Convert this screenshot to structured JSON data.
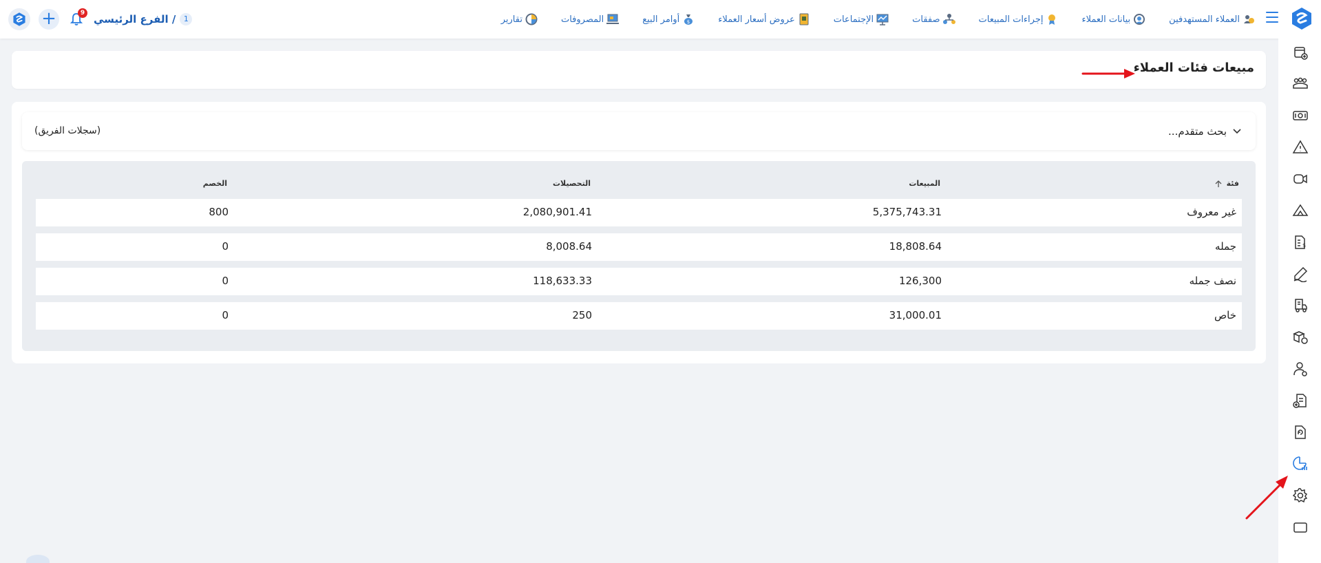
{
  "branch": {
    "number": "1",
    "name": "الفرع الرئيسي /"
  },
  "notifications": {
    "count": "9"
  },
  "nav_items": [
    {
      "label": "العملاء المستهدفين",
      "icon": "target-customers-icon"
    },
    {
      "label": "بيانات العملاء",
      "icon": "customer-data-icon"
    },
    {
      "label": "إجراءات المبيعات",
      "icon": "sales-actions-icon"
    },
    {
      "label": "صفقات",
      "icon": "deals-icon"
    },
    {
      "label": "الإجتماعات",
      "icon": "meetings-icon"
    },
    {
      "label": "عروض أسعار العملاء",
      "icon": "quotes-icon"
    },
    {
      "label": "أوامر البيع",
      "icon": "sales-orders-icon"
    },
    {
      "label": "المصروفات",
      "icon": "expenses-icon"
    },
    {
      "label": "تقارير",
      "icon": "reports-icon"
    }
  ],
  "page": {
    "title": "مبيعات فئات العملاء"
  },
  "search": {
    "advanced_label": "بحث متقدم...",
    "team_records": "(سجلات الفريق)"
  },
  "table": {
    "headers": {
      "category": "فئة",
      "sales": "المبيعات",
      "collections": "التحصيلات",
      "discount": "الخصم"
    },
    "rows": [
      {
        "category": "غير معروف",
        "sales": "5,375,743.31",
        "collections": "2,080,901.41",
        "discount": "800"
      },
      {
        "category": "جمله",
        "sales": "18,808.64",
        "collections": "8,008.64",
        "discount": "0"
      },
      {
        "category": "نصف جمله",
        "sales": "126,300",
        "collections": "118,633.33",
        "discount": "0"
      },
      {
        "category": "خاص",
        "sales": "31,000.01",
        "collections": "250",
        "discount": "0"
      }
    ]
  },
  "colors": {
    "accent": "#2a7de1",
    "nav_text": "#2d6fc1",
    "badge": "#e02424",
    "annotation_arrow": "#e4141b"
  },
  "sidebar_icons": [
    "new-document-icon",
    "groups-icon",
    "cash-icon",
    "warning-icon",
    "video-icon",
    "triangle-tent-icon",
    "invoice-dollar-icon",
    "signature-pen-icon",
    "delivery-truck-icon",
    "package-box-icon",
    "user-dollar-icon",
    "medical-document-icon",
    "refresh-document-icon",
    "report-chart-icon",
    "settings-gear-icon",
    "window-icon"
  ]
}
